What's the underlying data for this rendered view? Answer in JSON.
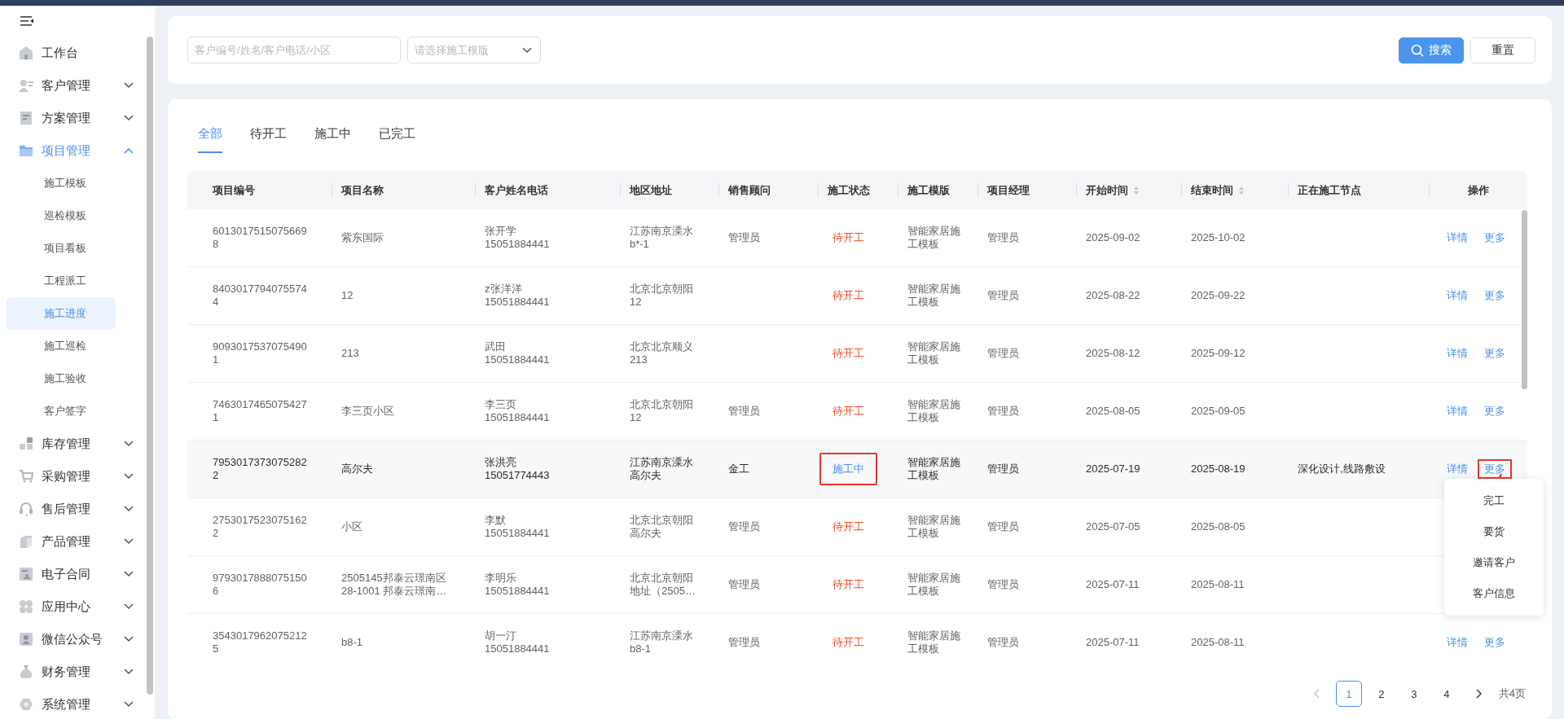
{
  "sidebar": {
    "items": [
      {
        "label": "工作台",
        "kind": "link",
        "selected": false
      },
      {
        "label": "客户管理",
        "kind": "group",
        "expanded": false,
        "selected": false
      },
      {
        "label": "方案管理",
        "kind": "group",
        "expanded": false,
        "selected": false
      },
      {
        "label": "项目管理",
        "kind": "group",
        "expanded": true,
        "selected": false,
        "children": [
          {
            "label": "施工模板",
            "selected": false
          },
          {
            "label": "巡检模板",
            "selected": false
          },
          {
            "label": "项目看板",
            "selected": false
          },
          {
            "label": "工程派工",
            "selected": false
          },
          {
            "label": "施工进度",
            "selected": true
          },
          {
            "label": "施工巡检",
            "selected": false
          },
          {
            "label": "施工验收",
            "selected": false
          },
          {
            "label": "客户签字",
            "selected": false
          }
        ]
      },
      {
        "label": "库存管理",
        "kind": "group",
        "expanded": false,
        "selected": false
      },
      {
        "label": "采购管理",
        "kind": "group",
        "expanded": false,
        "selected": false
      },
      {
        "label": "售后管理",
        "kind": "group",
        "expanded": false,
        "selected": false
      },
      {
        "label": "产品管理",
        "kind": "group",
        "expanded": false,
        "selected": false
      },
      {
        "label": "电子合同",
        "kind": "group",
        "expanded": false,
        "selected": false
      },
      {
        "label": "应用中心",
        "kind": "group",
        "expanded": false,
        "selected": false
      },
      {
        "label": "微信公众号",
        "kind": "group",
        "expanded": false,
        "selected": false
      },
      {
        "label": "财务管理",
        "kind": "group",
        "expanded": false,
        "selected": false
      },
      {
        "label": "系统管理",
        "kind": "group",
        "expanded": false,
        "selected": false
      }
    ]
  },
  "filters": {
    "search": {
      "placeholder": "客户编号/姓名/客户电话/小区"
    },
    "template_select": {
      "placeholder": "请选择施工模版"
    },
    "buttons": [
      {
        "label": "搜索",
        "kind": "primary"
      },
      {
        "label": "重置",
        "kind": "default"
      }
    ]
  },
  "tabs": [
    {
      "label": "全部",
      "selected": true
    },
    {
      "label": "待开工",
      "selected": false
    },
    {
      "label": "施工中",
      "selected": false
    },
    {
      "label": "已完工",
      "selected": false
    }
  ],
  "table": {
    "columns": [
      {
        "label": "项目编号",
        "sortable": false
      },
      {
        "label": "项目名称",
        "sortable": false
      },
      {
        "label": "客户姓名电话",
        "sortable": false
      },
      {
        "label": "地区地址",
        "sortable": false
      },
      {
        "label": "销售顾问",
        "sortable": false
      },
      {
        "label": "施工状态",
        "sortable": false
      },
      {
        "label": "施工模版",
        "sortable": false
      },
      {
        "label": "项目经理",
        "sortable": false
      },
      {
        "label": "开始时间",
        "sortable": true
      },
      {
        "label": "结束时间",
        "sortable": true
      },
      {
        "label": "正在施工节点",
        "sortable": false
      },
      {
        "label": "操作",
        "sortable": false
      }
    ],
    "rows": [
      {
        "id": "60130175150756698",
        "name": "紫东国际",
        "customer": "张开学",
        "phone": "15051884441",
        "address": "江苏南京溧水b*-1",
        "sales": "管理员",
        "status": {
          "text": "待开工",
          "kind": "pending",
          "outlined": false
        },
        "template": "智能家居施工模板",
        "manager": "管理员",
        "start": "2025-09-02",
        "end": "2025-10-02",
        "node": "",
        "actions": [
          {
            "label": "详情",
            "outlined": false
          },
          {
            "label": "更多",
            "outlined": false
          }
        ],
        "hovered": false
      },
      {
        "id": "84030177940755744",
        "name": "12",
        "customer": "z张洋洋",
        "phone": "15051884441",
        "address": "北京北京朝阳12",
        "sales": "",
        "status": {
          "text": "待开工",
          "kind": "pending",
          "outlined": false
        },
        "template": "智能家居施工模板",
        "manager": "管理员",
        "start": "2025-08-22",
        "end": "2025-09-22",
        "node": "",
        "actions": [
          {
            "label": "详情",
            "outlined": false
          },
          {
            "label": "更多",
            "outlined": false
          }
        ],
        "hovered": false
      },
      {
        "id": "90930175370754901",
        "name": "213",
        "customer": "武田",
        "phone": "15051884441",
        "address": "北京北京顺义213",
        "sales": "",
        "status": {
          "text": "待开工",
          "kind": "pending",
          "outlined": false
        },
        "template": "智能家居施工模板",
        "manager": "管理员",
        "start": "2025-08-12",
        "end": "2025-09-12",
        "node": "",
        "actions": [
          {
            "label": "详情",
            "outlined": false
          },
          {
            "label": "更多",
            "outlined": false
          }
        ],
        "hovered": false
      },
      {
        "id": "74630174650754271",
        "name": "李三页小区",
        "customer": "李三页",
        "phone": "15051884441",
        "address": "北京北京朝阳12",
        "sales": "管理员",
        "status": {
          "text": "待开工",
          "kind": "pending",
          "outlined": false
        },
        "template": "智能家居施工模板",
        "manager": "管理员",
        "start": "2025-08-05",
        "end": "2025-09-05",
        "node": "",
        "actions": [
          {
            "label": "详情",
            "outlined": false
          },
          {
            "label": "更多",
            "outlined": false
          }
        ],
        "hovered": false
      },
      {
        "id": "79530173730752822",
        "name": "高尔夫",
        "customer": "张洪亮",
        "phone": "15051774443",
        "address": "江苏南京溧水高尔夫",
        "sales": "金工",
        "status": {
          "text": "施工中",
          "kind": "active",
          "outlined": true
        },
        "template": "智能家居施工模板",
        "manager": "管理员",
        "start": "2025-07-19",
        "end": "2025-08-19",
        "node": "深化设计,线路敷设",
        "actions": [
          {
            "label": "详情",
            "outlined": false
          },
          {
            "label": "更多",
            "outlined": true
          }
        ],
        "hovered": true
      },
      {
        "id": "27530175230751622",
        "name": "小区",
        "customer": "李默",
        "phone": "15051884441",
        "address": "北京北京朝阳高尔夫",
        "sales": "管理员",
        "status": {
          "text": "待开工",
          "kind": "pending",
          "outlined": false
        },
        "template": "智能家居施工模板",
        "manager": "管理员",
        "start": "2025-07-05",
        "end": "2025-08-05",
        "node": "",
        "actions": [],
        "hovered": false
      },
      {
        "id": "97930178880751506",
        "name": "2505145邦泰云璟南区28-1001 邦泰云璟南…",
        "customer": "李明乐",
        "phone": "15051884441",
        "address": "北京北京朝阳地址（2505…",
        "sales": "管理员",
        "status": {
          "text": "待开工",
          "kind": "pending",
          "outlined": false
        },
        "template": "智能家居施工模板",
        "manager": "管理员",
        "start": "2025-07-11",
        "end": "2025-08-11",
        "node": "",
        "actions": [],
        "hovered": false
      },
      {
        "id": "35430179620752125",
        "name": "b8-1",
        "customer": "胡一汀",
        "phone": "15051884441",
        "address": "江苏南京溧水b8-1",
        "sales": "管理员",
        "status": {
          "text": "待开工",
          "kind": "pending",
          "outlined": false
        },
        "template": "智能家居施工模板",
        "manager": "管理员",
        "start": "2025-07-11",
        "end": "2025-08-11",
        "node": "",
        "actions": [
          {
            "label": "详情",
            "outlined": false
          },
          {
            "label": "更多",
            "outlined": false
          }
        ],
        "hovered": false
      }
    ]
  },
  "dropdown": {
    "items": [
      {
        "label": "完工"
      },
      {
        "label": "要货"
      },
      {
        "label": "邀请客户"
      },
      {
        "label": "客户信息"
      }
    ]
  },
  "pagination": {
    "prev_disabled": true,
    "pages": [
      {
        "label": "1",
        "selected": true
      },
      {
        "label": "2",
        "selected": false
      },
      {
        "label": "3",
        "selected": false
      },
      {
        "label": "4",
        "selected": false
      }
    ],
    "total": "共4页"
  }
}
